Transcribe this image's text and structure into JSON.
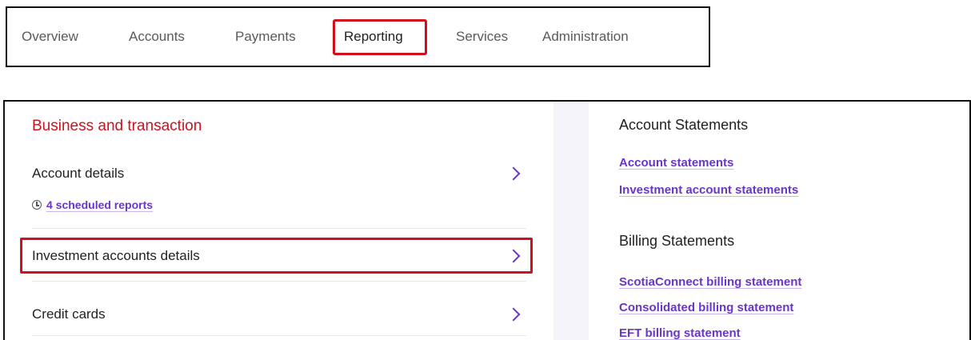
{
  "topnav": {
    "items": [
      {
        "label": "Overview"
      },
      {
        "label": "Accounts"
      },
      {
        "label": "Payments"
      },
      {
        "label": "Reporting"
      },
      {
        "label": "Services"
      },
      {
        "label": "Administration"
      }
    ],
    "active": "Reporting"
  },
  "left": {
    "section_title": "Business and transaction",
    "rows": [
      {
        "label": "Account details"
      },
      {
        "label": "Investment accounts details"
      },
      {
        "label": "Credit cards"
      }
    ],
    "scheduled_reports": "4 scheduled reports"
  },
  "right": {
    "groups": [
      {
        "heading": "Account Statements",
        "links": [
          "Account statements",
          "Investment account statements"
        ]
      },
      {
        "heading": "Billing Statements",
        "links": [
          "ScotiaConnect billing statement",
          "Consolidated billing statement",
          "EFT billing statement"
        ]
      }
    ]
  },
  "colors": {
    "accent_red": "#d0101d",
    "link_purple": "#6a35c9",
    "highlight_box": "#d0101d"
  }
}
